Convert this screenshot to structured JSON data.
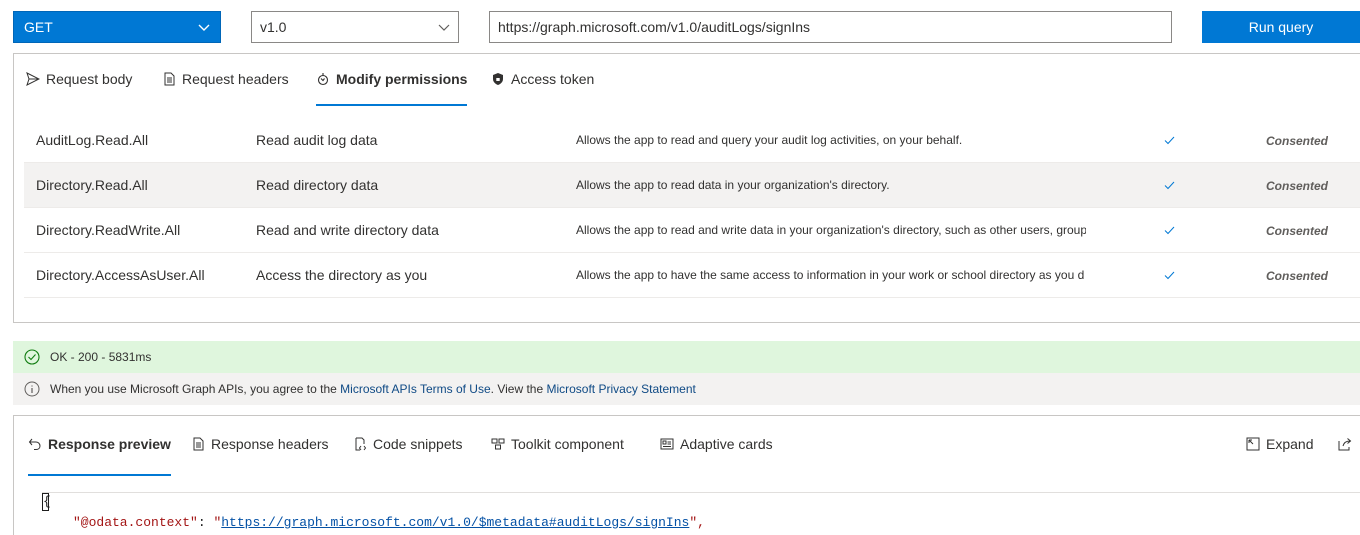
{
  "query_bar": {
    "method": "GET",
    "version": "v1.0",
    "url": "https://graph.microsoft.com/v1.0/auditLogs/signIns",
    "run_label": "Run query"
  },
  "request_tabs": [
    {
      "label": "Request body",
      "icon": "send-icon",
      "active": false
    },
    {
      "label": "Request headers",
      "icon": "document-icon",
      "active": false
    },
    {
      "label": "Modify permissions",
      "icon": "key-icon",
      "active": true
    },
    {
      "label": "Access token",
      "icon": "shield-icon",
      "active": false
    }
  ],
  "permissions": [
    {
      "name": "AuditLog.Read.All",
      "display": "Read audit log data",
      "description": "Allows the app to read and query your audit log activities, on your behalf.",
      "status": "Consented"
    },
    {
      "name": "Directory.Read.All",
      "display": "Read directory data",
      "description": "Allows the app to read data in your organization's directory.",
      "status": "Consented"
    },
    {
      "name": "Directory.ReadWrite.All",
      "display": "Read and write directory data",
      "description": "Allows the app to read and write data in your organization's directory, such as other users, group",
      "status": "Consented"
    },
    {
      "name": "Directory.AccessAsUser.All",
      "display": "Access the directory as you",
      "description": "Allows the app to have the same access to information in your work or school directory as you d",
      "status": "Consented"
    }
  ],
  "status": {
    "text": "OK - 200 - 5831ms",
    "color": "#dff6dd"
  },
  "notice": {
    "prefix": "When you use Microsoft Graph APIs, you agree to the ",
    "terms_link": "Microsoft APIs Terms of Use",
    "middle": ". View the ",
    "privacy_link": "Microsoft Privacy Statement"
  },
  "response_tabs": [
    {
      "label": "Response preview",
      "icon": "undo-icon",
      "active": true
    },
    {
      "label": "Response headers",
      "icon": "document-icon",
      "active": false
    },
    {
      "label": "Code snippets",
      "icon": "code-icon",
      "active": false
    },
    {
      "label": "Toolkit component",
      "icon": "toolkit-icon",
      "active": false
    },
    {
      "label": "Adaptive cards",
      "icon": "card-icon",
      "active": false
    }
  ],
  "response_actions": {
    "expand_label": "Expand"
  },
  "code": {
    "open_brace": "{",
    "line1_key": "\"@odata.context\"",
    "line1_sep": ": ",
    "line1_quote_open": "\"",
    "line1_value": "https://graph.microsoft.com/v1.0/$metadata#auditLogs/signIns",
    "line1_tail": "\","
  },
  "colors": {
    "accent": "#0078d4",
    "link": "#0f4a85",
    "success_bg": "#dff6dd",
    "check": "#0078d4"
  }
}
